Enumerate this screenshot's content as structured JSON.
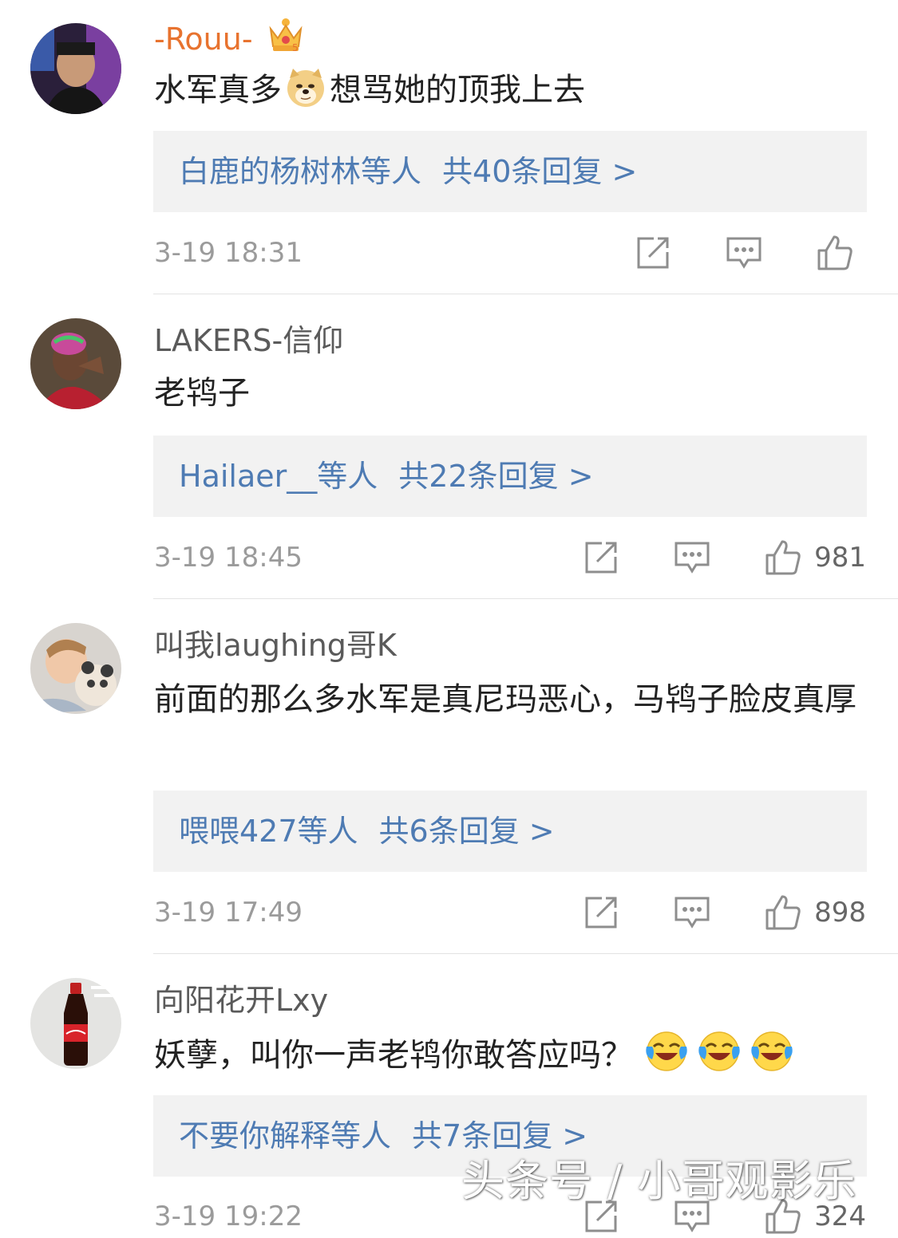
{
  "comments": [
    {
      "username": "-Rouu-",
      "content_before": "水军真多",
      "content_after": "想骂她的顶我上去",
      "reply_users": "白鹿的杨树林等人",
      "reply_count": "共40条回复 >",
      "time": "3-19 18:31",
      "likes": ""
    },
    {
      "username": "LAKERS-信仰",
      "content": "老鸨子",
      "reply_users": "Hailaer__等人",
      "reply_count": "共22条回复 >",
      "time": "3-19 18:45",
      "likes": "981"
    },
    {
      "username": "叫我laughing哥K",
      "content": "前面的那么多水军是真尼玛恶心，马鸨子脸皮真厚",
      "reply_users": "喂喂427等人",
      "reply_count": "共6条回复 >",
      "time": "3-19 17:49",
      "likes": "898"
    },
    {
      "username": "向阳花开Lxy",
      "content": "妖孽，叫你一声老鸨你敢答应吗？",
      "reply_users": "不要你解释等人",
      "reply_count": "共7条回复 >",
      "time": "3-19 19:22",
      "likes": "324"
    }
  ],
  "watermark": "头条号 / 小哥观影乐",
  "colors": {
    "vip_name": "#e8732f",
    "link_blue": "#4e7bb3",
    "reply_bg": "#f2f2f2",
    "meta_gray": "#9b9b9b"
  },
  "icons": [
    "crown-icon",
    "doge-emoji",
    "share-icon",
    "comment-icon",
    "like-icon",
    "laughing-crying-emoji"
  ]
}
